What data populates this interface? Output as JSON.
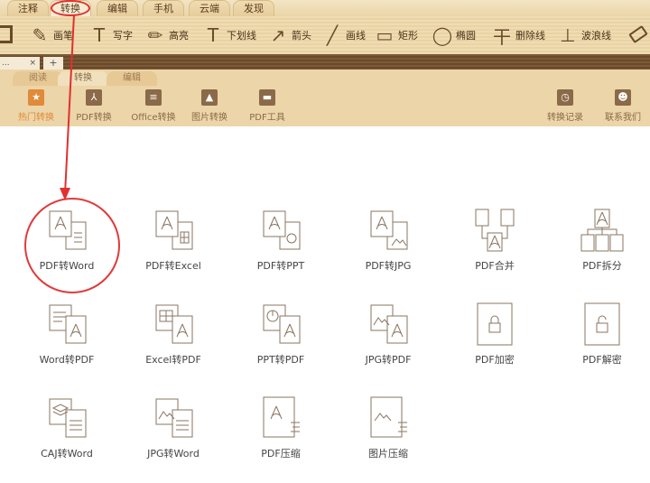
{
  "top_tabs": [
    "注释",
    "转换",
    "编辑",
    "手机",
    "云端",
    "发现"
  ],
  "active_top_tab": 1,
  "tools": [
    {
      "icon": "pen-icon",
      "label": "画笔"
    },
    {
      "icon": "text-tool-icon",
      "label": "写字"
    },
    {
      "icon": "highlight-icon",
      "label": "高亮"
    },
    {
      "icon": "underline-icon",
      "label": "下划线"
    },
    {
      "icon": "arrow-tool-icon",
      "label": "箭头"
    },
    {
      "icon": "line-icon",
      "label": "画线"
    },
    {
      "icon": "rectangle-icon",
      "label": "矩形"
    },
    {
      "icon": "ellipse-icon",
      "label": "椭圆"
    },
    {
      "icon": "strikethrough-icon",
      "label": "删除线"
    },
    {
      "icon": "wavy-line-icon",
      "label": "波浪线"
    }
  ],
  "doc_tab": {
    "title": "...",
    "close": "×",
    "new": "+"
  },
  "sub_tabs": [
    "阅读",
    "转换",
    "编辑"
  ],
  "categories": [
    {
      "icon": "star-icon",
      "label": "热门转换"
    },
    {
      "icon": "pdf-icon",
      "label": "PDF转换"
    },
    {
      "icon": "office-icon",
      "label": "Office转换"
    },
    {
      "icon": "image-icon",
      "label": "图片转换"
    },
    {
      "icon": "toolbox-icon",
      "label": "PDF工具"
    }
  ],
  "right_actions": [
    {
      "icon": "clock-icon",
      "label": "转换记录"
    },
    {
      "icon": "headset-icon",
      "label": "联系我们"
    }
  ],
  "functions": [
    {
      "label": "PDF转Word",
      "kind": "pdf-word"
    },
    {
      "label": "PDF转Excel",
      "kind": "pdf-excel"
    },
    {
      "label": "PDF转PPT",
      "kind": "pdf-ppt"
    },
    {
      "label": "PDF转JPG",
      "kind": "pdf-jpg"
    },
    {
      "label": "PDF合并",
      "kind": "merge"
    },
    {
      "label": "PDF拆分",
      "kind": "split"
    },
    {
      "label": "Word转PDF",
      "kind": "word-pdf"
    },
    {
      "label": "Excel转PDF",
      "kind": "excel-pdf"
    },
    {
      "label": "PPT转PDF",
      "kind": "ppt-pdf"
    },
    {
      "label": "JPG转PDF",
      "kind": "jpg-pdf"
    },
    {
      "label": "PDF加密",
      "kind": "lock"
    },
    {
      "label": "PDF解密",
      "kind": "unlock"
    },
    {
      "label": "CAJ转Word",
      "kind": "caj-word"
    },
    {
      "label": "JPG转Word",
      "kind": "jpg-word"
    },
    {
      "label": "PDF压缩",
      "kind": "compress"
    },
    {
      "label": "图片压缩",
      "kind": "img-compress"
    }
  ],
  "accent": "#e08a3a",
  "highlight": "#e03a3a"
}
